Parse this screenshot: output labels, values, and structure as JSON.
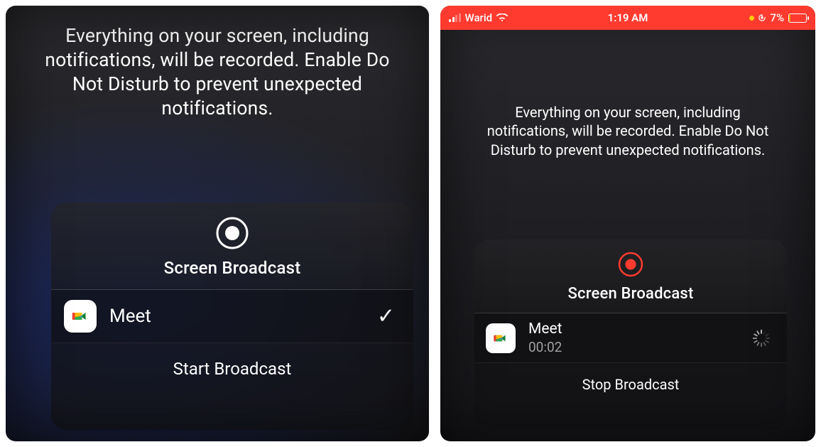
{
  "left": {
    "instruction": "Everything on your screen, including notifications, will be recorded. Enable Do Not Disturb to prevent unexpected notifications.",
    "sheet_title": "Screen Broadcast",
    "app_name": "Meet",
    "action_label": "Start Broadcast",
    "record_icon": "record-icon",
    "app_icon": "google-meet-icon",
    "selected_icon": "checkmark-icon"
  },
  "right": {
    "status": {
      "carrier": "Warid",
      "time": "1:19 AM",
      "battery_percent": "7%",
      "battery_level": 0.07,
      "signal_bars_on": 2
    },
    "instruction": "Everything on your screen, including notifications, will be recorded. Enable Do Not Disturb to prevent unexpected notifications.",
    "sheet_title": "Screen Broadcast",
    "app_name": "Meet",
    "elapsed": "00:02",
    "action_label": "Stop Broadcast",
    "record_icon": "record-active-icon",
    "app_icon": "google-meet-icon",
    "loading_icon": "spinner-icon"
  }
}
